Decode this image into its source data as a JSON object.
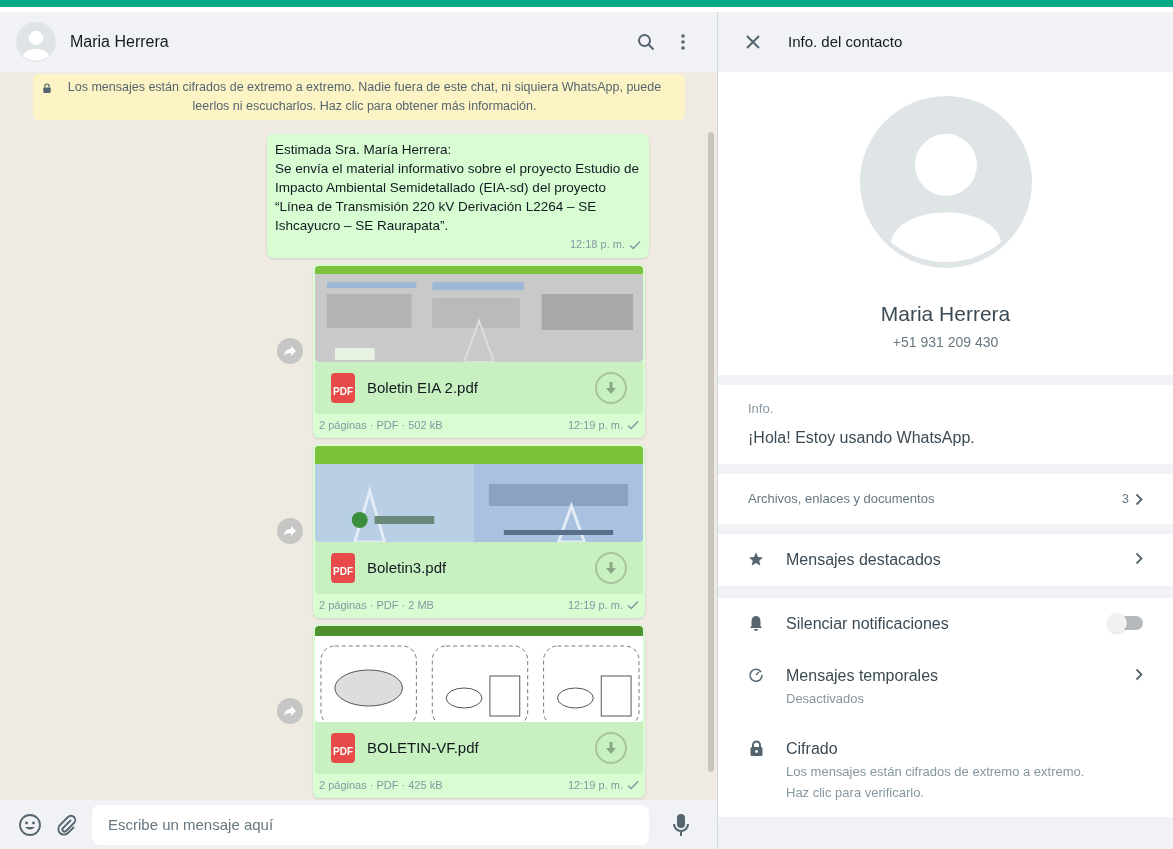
{
  "chat": {
    "contact_name": "Maria Herrera",
    "encryption_notice": "Los mensajes están cifrados de extremo a extremo. Nadie fuera de este chat, ni siquiera WhatsApp, puede leerlos ni escucharlos. Haz clic para obtener más información.",
    "messages": [
      {
        "kind": "text",
        "greeting": "Estimada Sra. María Herrera:",
        "body": "Se envía el material informativo sobre el proyecto Estudio de Impacto Ambiental Semidetallado (EIA-sd) del proyecto “Línea de Transmisión 220 kV Derivación L2264 – SE Ishcayucro – SE Raurapata”.",
        "time": "12:18 p. m.",
        "delivered": false
      },
      {
        "kind": "document",
        "file_name": "Boletin EIA 2.pdf",
        "icon_label": "PDF",
        "details": "2 páginas · PDF · 502 kB",
        "time": "12:19 p. m.",
        "delivered": false
      },
      {
        "kind": "document",
        "file_name": "Boletin3.pdf",
        "icon_label": "PDF",
        "details": "2 páginas · PDF · 2 MB",
        "time": "12:19 p. m.",
        "delivered": false
      },
      {
        "kind": "document",
        "file_name": "BOLETIN-VF.pdf",
        "icon_label": "PDF",
        "details": "2 páginas · PDF · 425 kB",
        "time": "12:19 p. m.",
        "delivered": false
      }
    ],
    "composer": {
      "placeholder": "Escribe un mensaje aquí"
    }
  },
  "contact_info": {
    "title": "Info. del contacto",
    "name": "Maria Herrera",
    "phone": "+51 931 209 430",
    "about_label": "Info.",
    "about": "¡Hola! Estoy usando WhatsApp.",
    "media": {
      "label": "Archivos, enlaces y documentos",
      "count": "3"
    },
    "options": [
      {
        "kind": "starred",
        "label": "Mensajes destacados"
      },
      {
        "kind": "mute",
        "label": "Silenciar notificaciones",
        "on": false
      },
      {
        "kind": "disappearing",
        "label": "Mensajes temporales",
        "subtitle": "Desactivados"
      },
      {
        "kind": "encryption",
        "label": "Cifrado",
        "subtitle": "Los mensajes están cifrados de extremo a extremo. Haz clic para verificarlo."
      }
    ]
  }
}
